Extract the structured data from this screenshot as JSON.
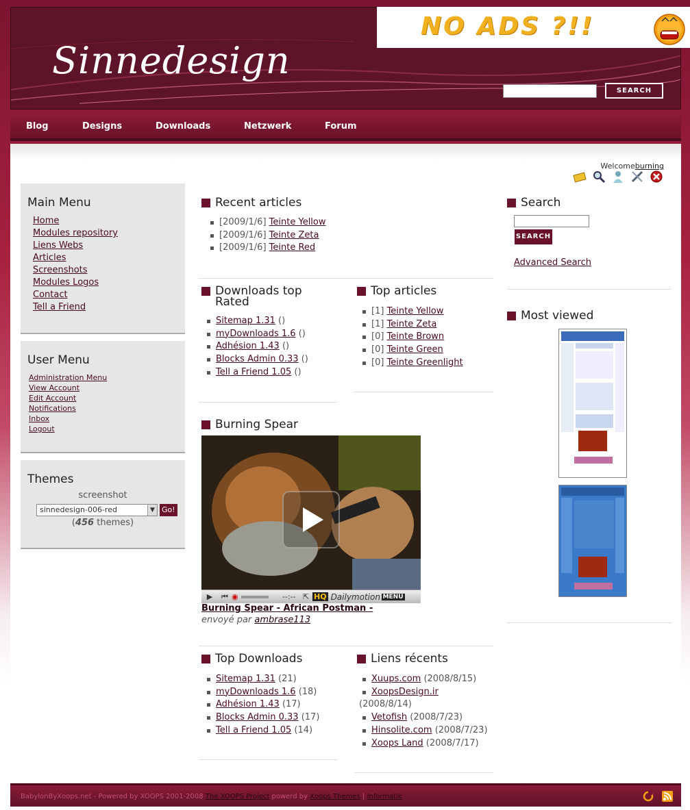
{
  "site": {
    "logo_text": "Sinnedesign"
  },
  "ad": {
    "text": "NO ADS ?!!"
  },
  "search_top": {
    "button_label": "Search",
    "input_value": ""
  },
  "nav": [
    "Blog",
    "Designs",
    "Downloads",
    "Netzwerk",
    "Forum"
  ],
  "welcome": {
    "prefix": "Welcome",
    "user": "burning"
  },
  "main_menu": {
    "title": "Main Menu",
    "items": [
      "Home",
      "Modules repository",
      "Liens Webs",
      "Articles",
      "Screenshots",
      "Modules Logos",
      "Contact",
      "Tell a Friend"
    ]
  },
  "user_menu": {
    "title": "User Menu",
    "items": [
      "Administration Menu",
      "View Account",
      "Edit Account",
      "Notifications",
      "Inbox",
      "Logout"
    ]
  },
  "themes": {
    "title": "Themes",
    "label": "screenshot",
    "selected": "sinnedesign-006-red",
    "go": "Go!",
    "count": "456",
    "count_suffix": " themes)",
    "count_prefix": "("
  },
  "recent_articles": {
    "title": "Recent articles",
    "items": [
      {
        "date": "[2009/1/6]",
        "link": "Teinte Yellow"
      },
      {
        "date": "[2009/1/6]",
        "link": "Teinte Zeta"
      },
      {
        "date": "[2009/1/6]",
        "link": "Teinte Red"
      }
    ]
  },
  "downloads_top_rated": {
    "title": "Downloads top Rated",
    "items": [
      {
        "link": "Sitemap 1.31",
        "extra": " ()"
      },
      {
        "link": "myDownloads 1.6",
        "extra": " ()"
      },
      {
        "link": "Adhésion 1.43",
        "extra": " ()"
      },
      {
        "link": "Blocks Admin 0.33",
        "extra": " ()"
      },
      {
        "link": "Tell a Friend 1.05",
        "extra": " ()"
      }
    ]
  },
  "top_articles": {
    "title": "Top articles",
    "items": [
      {
        "count": "[1]",
        "link": "Teinte Yellow"
      },
      {
        "count": "[1]",
        "link": "Teinte Zeta"
      },
      {
        "count": "[0]",
        "link": "Teinte Brown"
      },
      {
        "count": "[0]",
        "link": "Teinte Green"
      },
      {
        "count": "[0]",
        "link": "Teinte Greenlight"
      }
    ]
  },
  "video": {
    "title": "Burning Spear",
    "caption_link": "Burning Spear - African Postman -",
    "sent_by": "envoyé par",
    "author": "ambrase113",
    "brand": "Dailymotion",
    "hq": "HQ",
    "menu": "MENU",
    "time": "--:--"
  },
  "top_downloads": {
    "title": "Top Downloads",
    "items": [
      {
        "link": "Sitemap 1.31",
        "extra": " (21)"
      },
      {
        "link": "myDownloads 1.6",
        "extra": " (18)"
      },
      {
        "link": "Adhésion 1.43",
        "extra": " (17)"
      },
      {
        "link": "Blocks Admin 0.33",
        "extra": " (17)"
      },
      {
        "link": "Tell a Friend 1.05",
        "extra": " (14)"
      }
    ]
  },
  "recent_links": {
    "title": "Liens récents",
    "items": [
      {
        "link": "Xuups.com",
        "extra": " (2008/8/15)"
      },
      {
        "link": "XoopsDesign.ir",
        "extra": " (2008/8/14)"
      },
      {
        "link": "Vetofish",
        "extra": " (2008/7/23)"
      },
      {
        "link": "Hinsolite.com",
        "extra": " (2008/7/23)"
      },
      {
        "link": "Xoops Land",
        "extra": " (2008/7/17)"
      }
    ]
  },
  "search_block": {
    "title": "Search",
    "button_label": "Search",
    "advanced": "Advanced Search"
  },
  "most_viewed": {
    "title": "Most viewed"
  },
  "footer": {
    "prefix": "BabylonByXoops.net - Powered by XOOPS 2001-2008 ",
    "link1": "The XOOPS Project",
    "mid": " powerd by ",
    "link2": "Xoops Themes",
    "sep": " | ",
    "link3": "Informatik"
  },
  "colors": {
    "brand": "#6a1229",
    "header": "#5e1428"
  }
}
